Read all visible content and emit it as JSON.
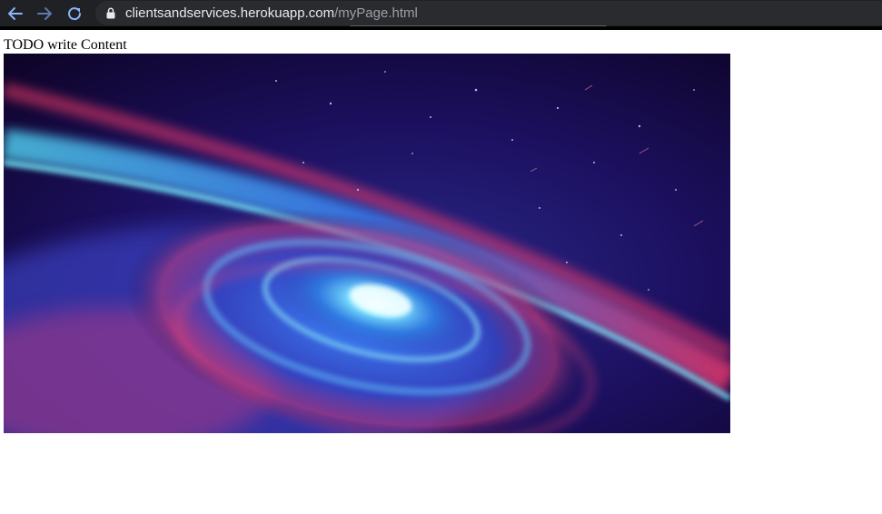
{
  "browser": {
    "url_host": "clientsandservices.herokuapp.com",
    "url_path": "/myPage.html",
    "icons": {
      "back": "back-arrow-icon",
      "forward": "forward-arrow-icon",
      "reload": "reload-icon",
      "lock": "lock-icon"
    }
  },
  "page": {
    "heading_text": "TODO write Content",
    "image": {
      "subject": "spiral galaxy nebula in space",
      "icon": "galaxy-image"
    }
  },
  "colors": {
    "toolbar_bg": "#202124",
    "omnibox_bg": "#2a2b2e",
    "url_host": "#e8eaed",
    "url_path": "#9aa0a6",
    "nav_active": "#8ab4f8"
  }
}
